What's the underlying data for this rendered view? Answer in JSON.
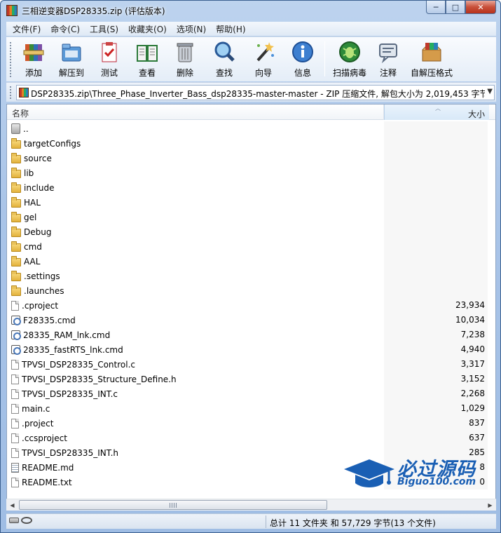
{
  "window": {
    "title": "三相逆变器DSP28335.zip (评估版本)",
    "controls": {
      "minimize": "─",
      "maximize": "□",
      "close": "✕"
    }
  },
  "menu": [
    "文件(F)",
    "命令(C)",
    "工具(S)",
    "收藏夹(O)",
    "选项(N)",
    "帮助(H)"
  ],
  "toolbar": [
    {
      "label": "添加",
      "icon": "add-archive-icon"
    },
    {
      "label": "解压到",
      "icon": "extract-to-icon"
    },
    {
      "label": "测试",
      "icon": "test-icon"
    },
    {
      "label": "查看",
      "icon": "view-icon"
    },
    {
      "label": "删除",
      "icon": "delete-icon"
    },
    {
      "label": "查找",
      "icon": "find-icon"
    },
    {
      "label": "向导",
      "icon": "wizard-icon"
    },
    {
      "label": "信息",
      "icon": "info-icon"
    },
    {
      "label": "扫描病毒",
      "icon": "virus-scan-icon"
    },
    {
      "label": "注释",
      "icon": "comment-icon"
    },
    {
      "label": "自解压格式",
      "icon": "sfx-icon"
    }
  ],
  "address": {
    "path": "DSP28335.zip\\Three_Phase_Inverter_Bass_dsp28335-master-master - ZIP 压缩文件, 解包大小为 2,019,453 字节"
  },
  "columns": {
    "name": "名称",
    "size": "大小"
  },
  "files": [
    {
      "name": "..",
      "size": "",
      "type": "up"
    },
    {
      "name": "targetConfigs",
      "size": "",
      "type": "folder"
    },
    {
      "name": "source",
      "size": "",
      "type": "folder"
    },
    {
      "name": "lib",
      "size": "",
      "type": "folder"
    },
    {
      "name": "include",
      "size": "",
      "type": "folder"
    },
    {
      "name": "HAL",
      "size": "",
      "type": "folder"
    },
    {
      "name": "gel",
      "size": "",
      "type": "folder"
    },
    {
      "name": "Debug",
      "size": "",
      "type": "folder"
    },
    {
      "name": "cmd",
      "size": "",
      "type": "folder"
    },
    {
      "name": "AAL",
      "size": "",
      "type": "folder"
    },
    {
      "name": ".settings",
      "size": "",
      "type": "folder"
    },
    {
      "name": ".launches",
      "size": "",
      "type": "folder"
    },
    {
      "name": ".cproject",
      "size": "23,934",
      "type": "doc"
    },
    {
      "name": "F28335.cmd",
      "size": "10,034",
      "type": "cmd"
    },
    {
      "name": "28335_RAM_lnk.cmd",
      "size": "7,238",
      "type": "cmd"
    },
    {
      "name": "28335_fastRTS_lnk.cmd",
      "size": "4,940",
      "type": "cmd"
    },
    {
      "name": "TPVSI_DSP28335_Control.c",
      "size": "3,317",
      "type": "doc"
    },
    {
      "name": "TPVSI_DSP28335_Structure_Define.h",
      "size": "3,152",
      "type": "doc"
    },
    {
      "name": "TPVSI_DSP28335_INT.c",
      "size": "2,268",
      "type": "doc"
    },
    {
      "name": "main.c",
      "size": "1,029",
      "type": "doc"
    },
    {
      "name": ".project",
      "size": "837",
      "type": "doc"
    },
    {
      "name": ".ccsproject",
      "size": "637",
      "type": "doc"
    },
    {
      "name": "TPVSI_DSP28335_INT.h",
      "size": "285",
      "type": "doc"
    },
    {
      "name": "README.md",
      "size": "8",
      "type": "txt"
    },
    {
      "name": "README.txt",
      "size": "0",
      "type": "doc"
    }
  ],
  "status": {
    "summary": "总计 11 文件夹 和 57,729 字节(13 个文件)"
  },
  "watermark": {
    "title": "必过源码",
    "subtitle": "Biguo100.com"
  },
  "colors": {
    "accent": "#1a5fb4",
    "folder": "#e3b23c",
    "title_bar": "#a9c4e8"
  }
}
